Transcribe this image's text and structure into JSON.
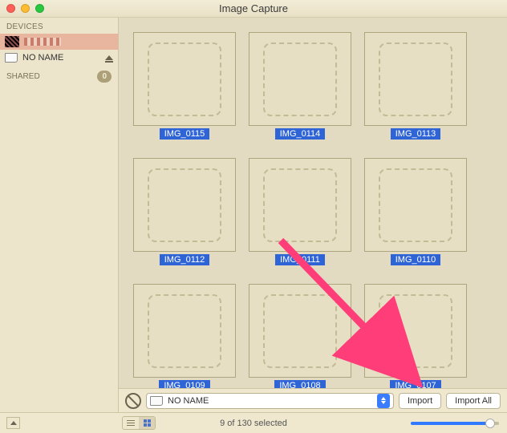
{
  "window": {
    "title": "Image Capture"
  },
  "sidebar": {
    "devices_label": "DEVICES",
    "shared_label": "SHARED",
    "shared_count": "0",
    "devices": [
      {
        "name": "",
        "kind": "phone",
        "selected": true
      },
      {
        "name": "NO NAME",
        "kind": "sd",
        "selected": false
      }
    ]
  },
  "grid": {
    "items": [
      {
        "label": "IMG_0115"
      },
      {
        "label": "IMG_0114"
      },
      {
        "label": "IMG_0113"
      },
      {
        "label": "IMG_0112"
      },
      {
        "label": "IMG_0111"
      },
      {
        "label": "IMG_0110"
      },
      {
        "label": "IMG_0109"
      },
      {
        "label": "IMG_0108"
      },
      {
        "label": "IMG_0107"
      }
    ]
  },
  "toolbar": {
    "destination": "NO NAME",
    "import_label": "Import",
    "import_all_label": "Import All"
  },
  "footer": {
    "status": "9 of 130 selected",
    "slider_pct": 90
  }
}
